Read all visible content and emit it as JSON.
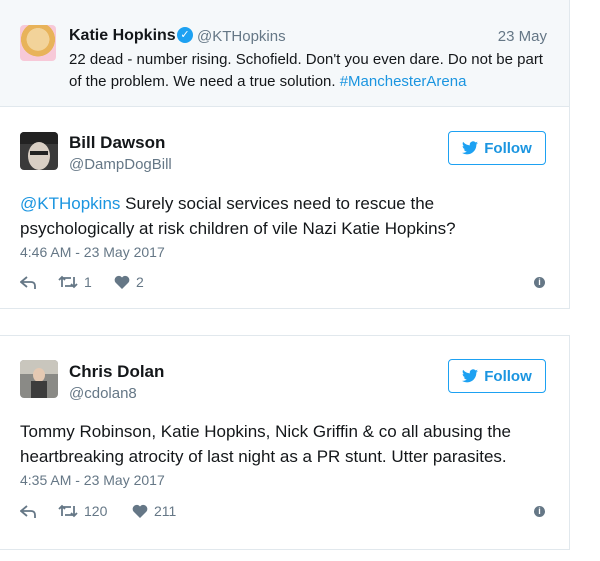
{
  "quoted": {
    "name": "Katie Hopkins",
    "handle": "@KTHopkins",
    "date": "23 May",
    "text": "22 dead - number rising. Schofield. Don't you even dare. Do not be part of the problem. We need a true solution. ",
    "hashtag": "#ManchesterArena"
  },
  "tweets": [
    {
      "name": "Bill Dawson",
      "handle": "@DampDogBill",
      "follow_label": "Follow",
      "mention": "@KTHopkins",
      "text": " Surely social services need to rescue the psychologically at risk children of vile Nazi Katie Hopkins?",
      "timestamp": "4:46 AM - 23 May 2017",
      "retweets": "1",
      "likes": "2"
    },
    {
      "name": "Chris Dolan",
      "handle": "@cdolan8",
      "follow_label": "Follow",
      "text": "Tommy Robinson, Katie Hopkins, Nick Griffin & co all abusing the heartbreaking atrocity of last night as a PR stunt. Utter parasites.",
      "timestamp": "4:35 AM - 23 May 2017",
      "retweets": "120",
      "likes": "211"
    }
  ],
  "colors": {
    "accent": "#1da1f2",
    "link": "#1b95e0",
    "muted": "#657786"
  }
}
